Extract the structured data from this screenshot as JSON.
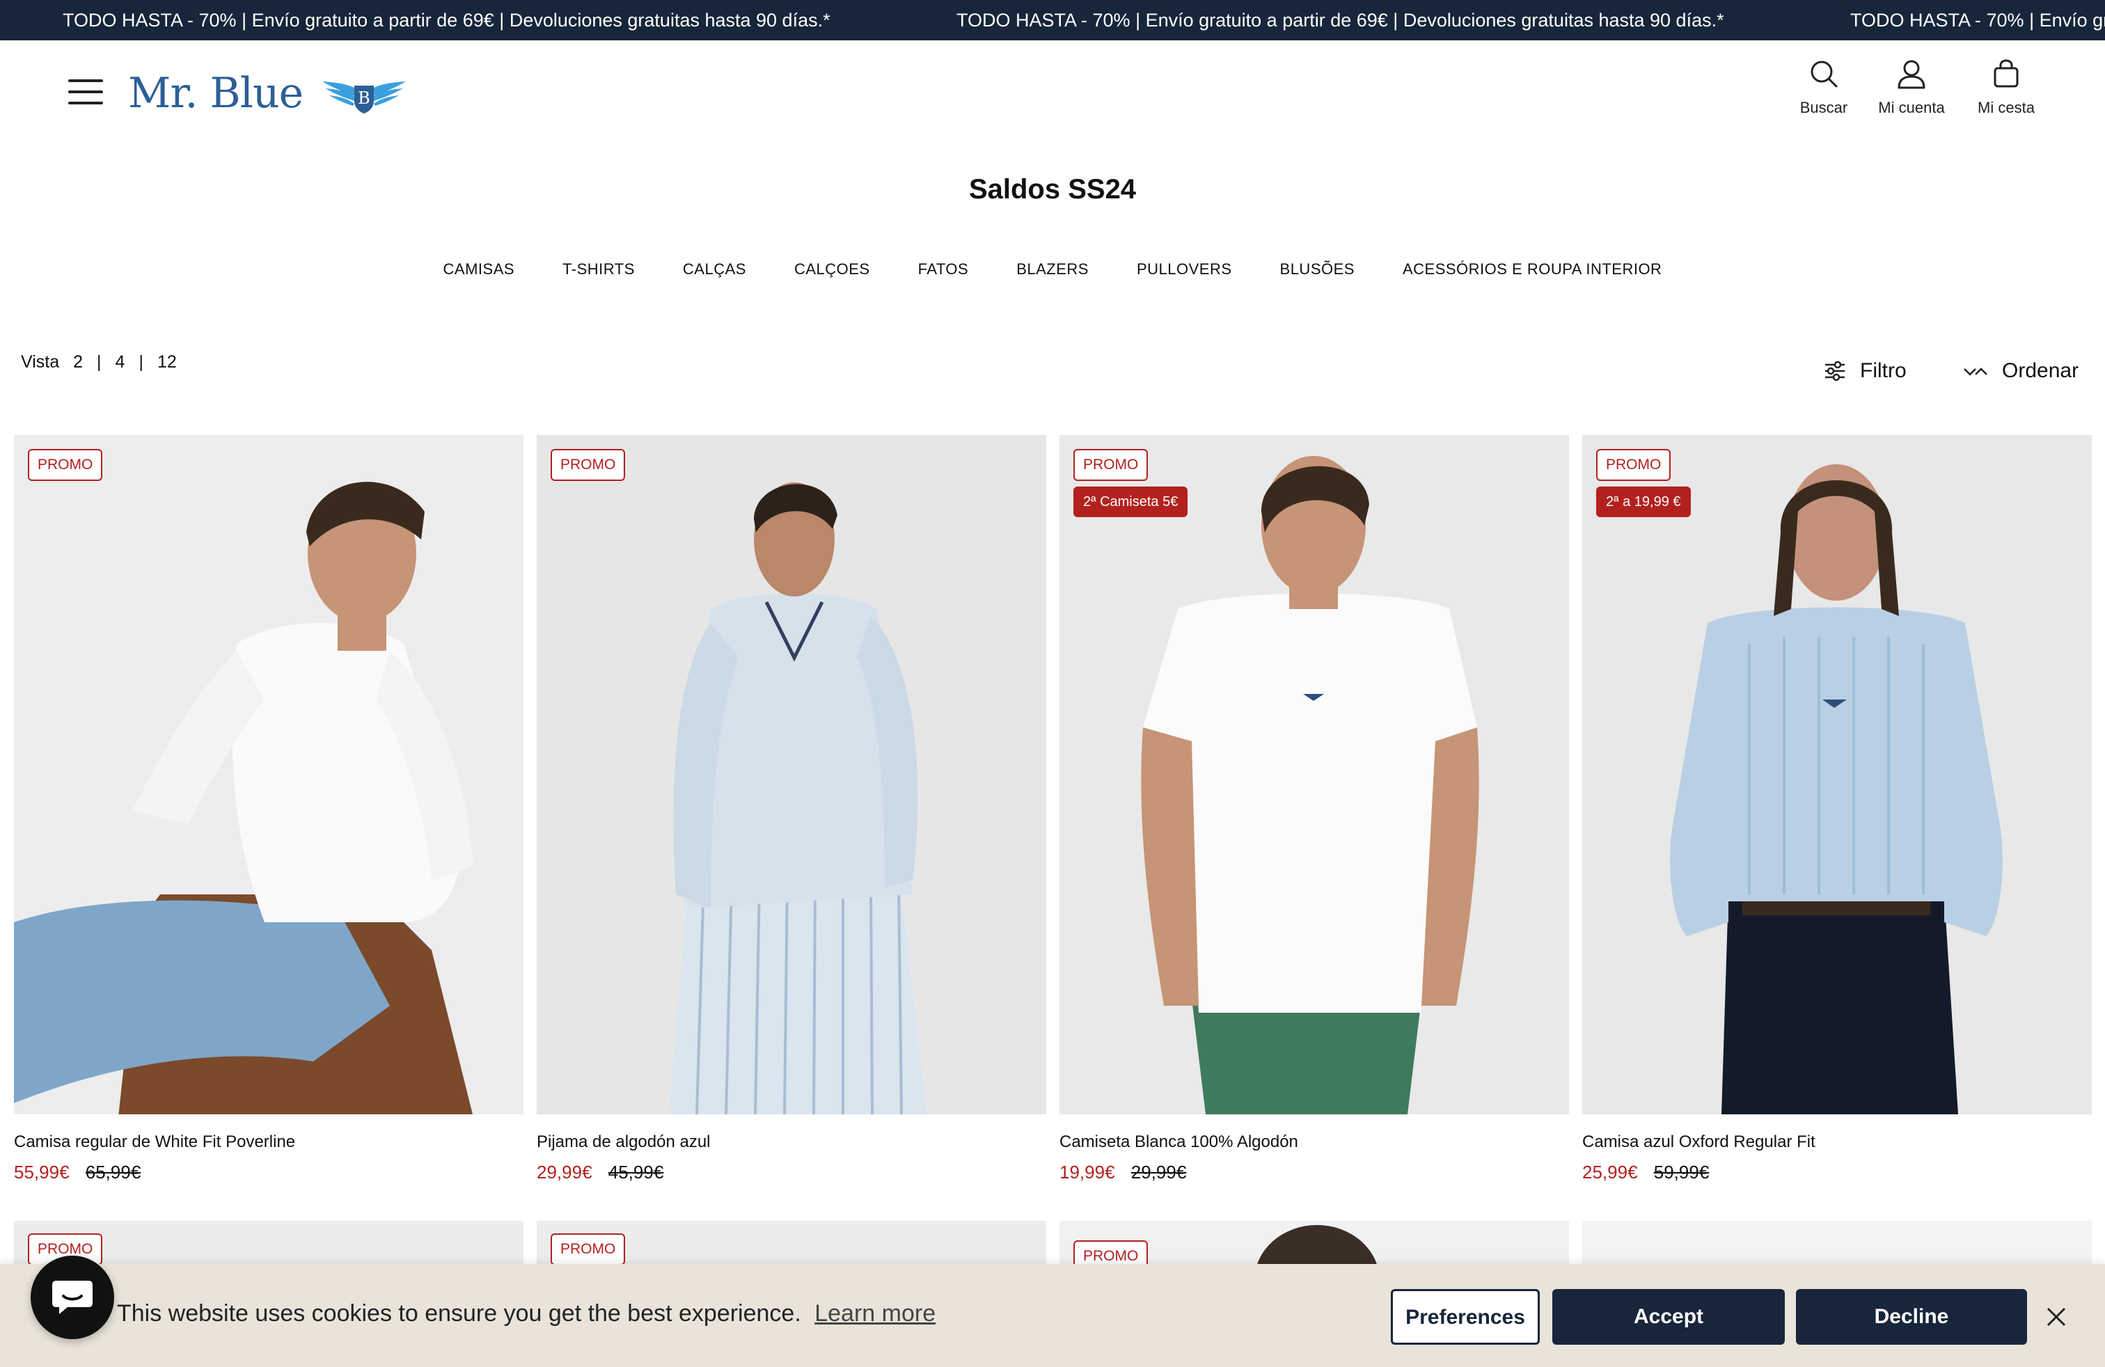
{
  "announcement": {
    "text": "TODO HASTA - 70% | Envío gratuito a partir de 69€ | Devoluciones gratuitas hasta 90 días.*"
  },
  "header": {
    "logo_text": "Mr. Blue",
    "logo_mark": "B",
    "icons": [
      {
        "label": "Buscar",
        "icon": "search-icon"
      },
      {
        "label": "Mi cuenta",
        "icon": "user-icon"
      },
      {
        "label": "Mi cesta",
        "icon": "bag-icon"
      }
    ]
  },
  "page_title": "Saldos SS24",
  "categories": [
    "CAMISAS",
    "T-SHIRTS",
    "CALÇAS",
    "CALÇOES",
    "FATOS",
    "BLAZERS",
    "PULLOVERS",
    "BLUSÕES",
    "ACESSÓRIOS E ROUPA INTERIOR"
  ],
  "view": {
    "label": "Vista",
    "options": [
      "2",
      "4",
      "12"
    ],
    "separator": "|"
  },
  "toolbar": {
    "filter_label": "Filtro",
    "sort_label": "Ordenar"
  },
  "products": [
    {
      "name": "Camisa regular de White Fit Poverline",
      "price": "55,99€",
      "old_price": "65,99€",
      "badge": "PROMO",
      "offer": ""
    },
    {
      "name": "Pijama de algodón azul",
      "price": "29,99€",
      "old_price": "45,99€",
      "badge": "PROMO",
      "offer": ""
    },
    {
      "name": "Camiseta Blanca 100% Algodón",
      "price": "19,99€",
      "old_price": "29,99€",
      "badge": "PROMO",
      "offer": "2ª Camiseta 5€"
    },
    {
      "name": "Camisa azul Oxford Regular Fit",
      "price": "25,99€",
      "old_price": "59,99€",
      "badge": "PROMO",
      "offer": "2ª a 19,99 €"
    }
  ],
  "second_row_badges": [
    "PROMO",
    "PROMO",
    "PROMO"
  ],
  "cookie": {
    "message": "This website uses cookies to ensure you get the best experience.",
    "learn_more": "Learn more",
    "preferences": "Preferences",
    "accept": "Accept",
    "decline": "Decline"
  },
  "colors": {
    "navy": "#17263a",
    "brand_blue": "#2d5f97",
    "sale_red": "#b3211e",
    "cookie_bg": "#e9e3d9"
  }
}
